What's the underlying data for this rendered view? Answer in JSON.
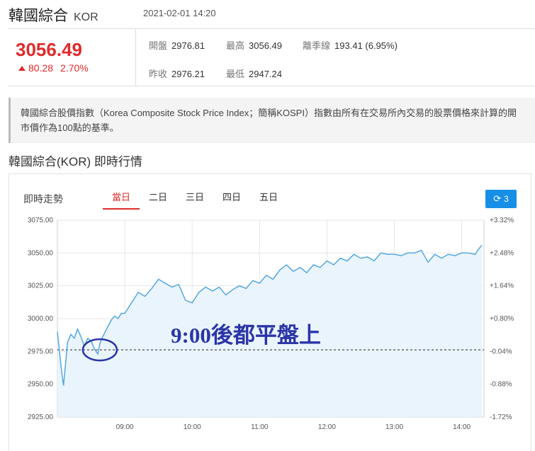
{
  "header": {
    "name": "韓國綜合",
    "code": "KOR",
    "datetime": "2021-02-01 14:20"
  },
  "quote": {
    "price": "3056.49",
    "change": "80.28",
    "change_pct": "2.70%",
    "up_color": "#e02b2b",
    "stats": [
      {
        "label": "開盤",
        "value": "2976.81"
      },
      {
        "label": "最高",
        "value": "3056.49"
      },
      {
        "label": "離季線",
        "value": "193.41 (6.95%)"
      },
      {
        "label": "昨收",
        "value": "2976.21"
      },
      {
        "label": "最低",
        "value": "2947.24"
      }
    ]
  },
  "description": "韓國綜合股價指數（Korea Composite Stock Price Index；簡稱KOSPI）指數由所有在交易所內交易的股票價格來計算的開市價作為100點的基準。",
  "section_title": "韓國綜合(KOR) 即時行情",
  "chart_panel": {
    "label": "即時走勢",
    "tabs": [
      "當日",
      "二日",
      "三日",
      "四日",
      "五日"
    ],
    "active_tab": 0,
    "refresh_label": "3",
    "refresh_icon": "refresh-icon",
    "accent_color": "#188fe6"
  },
  "chart_data": {
    "type": "area",
    "line_color": "#4aa3df",
    "fill_color": "#eaf4fc",
    "y_ticks": [
      "3075.00",
      "3050.00",
      "3025.00",
      "3000.00",
      "2975.00",
      "2950.00",
      "2925.00"
    ],
    "y_tick_values": [
      3075,
      3050,
      3025,
      3000,
      2975,
      2950,
      2925
    ],
    "pct_ticks": [
      "+3.32%",
      "+2.48%",
      "+1.64%",
      "+0.80%",
      "-0.04%",
      "-0.88%",
      "-1.72%"
    ],
    "pct_tick_colors": [
      "#e02b2b",
      "#e02b2b",
      "#e02b2b",
      "#e02b2b",
      "#2a9a3a",
      "#2a9a3a",
      "#2a9a3a"
    ],
    "x_ticks": [
      "09:00",
      "10:00",
      "11:00",
      "12:00",
      "13:00",
      "14:00"
    ],
    "x_tick_values": [
      9,
      10,
      11,
      12,
      13,
      14
    ],
    "ylim": [
      2925,
      3075
    ],
    "xlim": [
      8.0,
      14.33
    ],
    "prev_close": 2976.21,
    "annotation": "9:00後都平盤上",
    "x": [
      8.0,
      8.03,
      8.06,
      8.09,
      8.12,
      8.15,
      8.2,
      8.25,
      8.3,
      8.35,
      8.4,
      8.45,
      8.5,
      8.55,
      8.6,
      8.63,
      8.66,
      8.7,
      8.75,
      8.8,
      8.85,
      8.9,
      8.95,
      9.0,
      9.1,
      9.2,
      9.3,
      9.4,
      9.5,
      9.6,
      9.7,
      9.8,
      9.9,
      10.0,
      10.1,
      10.2,
      10.3,
      10.4,
      10.5,
      10.6,
      10.7,
      10.8,
      10.9,
      11.0,
      11.1,
      11.2,
      11.3,
      11.4,
      11.5,
      11.6,
      11.7,
      11.8,
      11.9,
      12.0,
      12.1,
      12.2,
      12.3,
      12.4,
      12.5,
      12.6,
      12.7,
      12.8,
      12.9,
      13.0,
      13.1,
      13.2,
      13.3,
      13.4,
      13.5,
      13.6,
      13.7,
      13.8,
      13.9,
      14.0,
      14.1,
      14.2,
      14.25,
      14.3
    ],
    "y": [
      2990,
      2975,
      2961,
      2949,
      2965,
      2982,
      2988,
      2985,
      2992,
      2986,
      2979,
      2985,
      2983,
      2977,
      2973,
      2981,
      2985,
      2989,
      2994,
      2999,
      3002,
      3000,
      3004,
      3004,
      3012,
      3020,
      3017,
      3023,
      3030,
      3027,
      3024,
      3026,
      3014,
      3012,
      3020,
      3024,
      3021,
      3024,
      3018,
      3022,
      3025,
      3023,
      3029,
      3027,
      3033,
      3030,
      3037,
      3041,
      3036,
      3039,
      3035,
      3041,
      3039,
      3044,
      3041,
      3046,
      3044,
      3049,
      3046,
      3047,
      3044,
      3050,
      3049,
      3049,
      3048,
      3050,
      3050,
      3052,
      3043,
      3049,
      3046,
      3049,
      3048,
      3050,
      3050,
      3049,
      3053,
      3056
    ]
  }
}
